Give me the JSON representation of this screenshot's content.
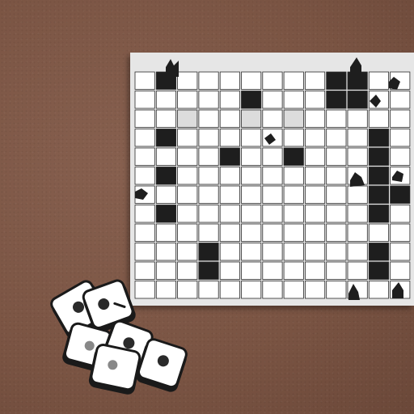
{
  "board": {
    "rows": 12,
    "cols": 13,
    "cell_color": "#ffffff",
    "block_color": "#1e1e1e",
    "shaded_color": "#dcdcdc",
    "board_color": "#e6e6e6",
    "blocks": [
      [
        0,
        1
      ],
      [
        0,
        9
      ],
      [
        0,
        10
      ],
      [
        1,
        5
      ],
      [
        1,
        9
      ],
      [
        1,
        10
      ],
      [
        3,
        1
      ],
      [
        3,
        11
      ],
      [
        4,
        4
      ],
      [
        4,
        7
      ],
      [
        4,
        11
      ],
      [
        5,
        1
      ],
      [
        5,
        11
      ],
      [
        6,
        11
      ],
      [
        6,
        12
      ],
      [
        7,
        1
      ],
      [
        7,
        11
      ],
      [
        9,
        3
      ],
      [
        9,
        11
      ],
      [
        10,
        3
      ],
      [
        10,
        11
      ]
    ],
    "shaded": [
      [
        2,
        2
      ],
      [
        2,
        5
      ],
      [
        2,
        7
      ]
    ]
  },
  "tiles": {
    "count": 5,
    "face_color": "#ffffff",
    "edge_color": "#1a1a1a",
    "pip_color": "#2a2a2a"
  }
}
